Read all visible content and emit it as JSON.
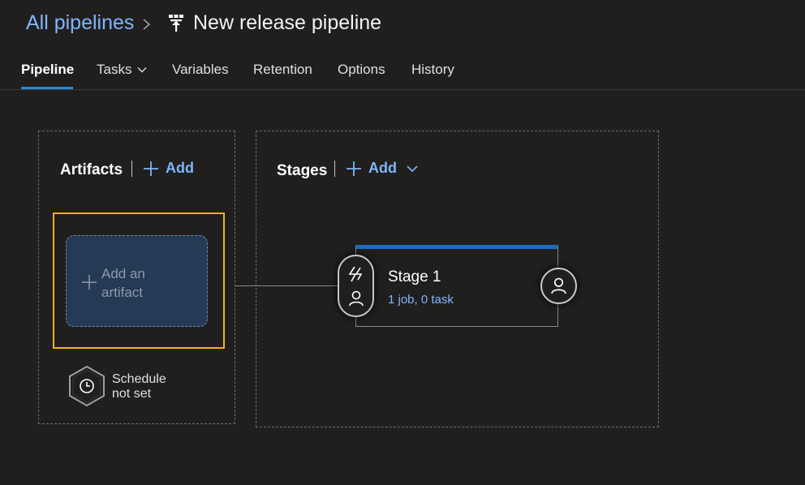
{
  "header": {
    "breadcrumb_link": "All pipelines",
    "title": "New release pipeline"
  },
  "tabs": [
    {
      "label": "Pipeline",
      "active": true
    },
    {
      "label": "Tasks",
      "has_dropdown": true
    },
    {
      "label": "Variables"
    },
    {
      "label": "Retention"
    },
    {
      "label": "Options"
    },
    {
      "label": "History"
    }
  ],
  "artifacts": {
    "title": "Artifacts",
    "add_label": "Add",
    "placeholder_line1": "Add an",
    "placeholder_line2": "artifact",
    "schedule_line1": "Schedule",
    "schedule_line2": "not set"
  },
  "stages": {
    "title": "Stages",
    "add_label": "Add",
    "items": [
      {
        "name": "Stage 1",
        "summary": "1 job, 0 task"
      }
    ]
  },
  "colors": {
    "background": "#201f1e",
    "link": "#7eb6ff",
    "accent": "#2b88d8",
    "stage_bar": "#1a6ec1",
    "focus": "#f2b01e",
    "artifact_card": "#243a55"
  },
  "icons": [
    "chevron-right-icon",
    "pipeline-icon",
    "chevron-down-icon",
    "plus-icon",
    "clock-icon",
    "lightning-icon",
    "person-icon"
  ]
}
